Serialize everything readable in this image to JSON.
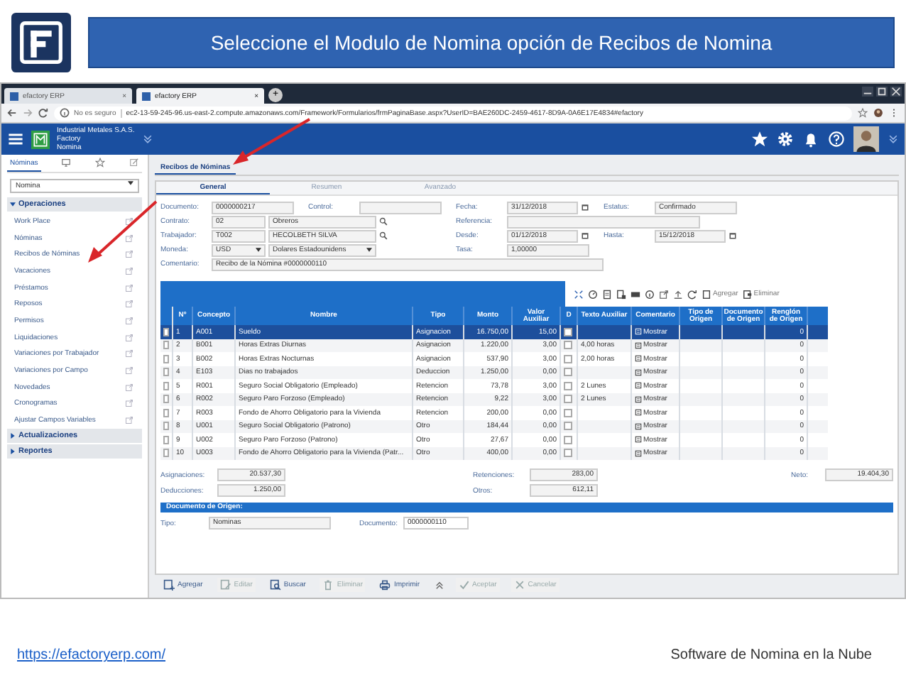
{
  "slide": {
    "title": "Seleccione el Modulo de Nomina opción de Recibos de Nomina",
    "link": "https://efactoryerp.com/",
    "tagline": "Software de Nomina en la Nube"
  },
  "browser": {
    "tabs": [
      {
        "label": "efactory ERP",
        "close": "×",
        "selected": false
      },
      {
        "label": "efactory ERP",
        "close": "×",
        "selected": true
      }
    ],
    "new_tab": "+",
    "security": "No es seguro",
    "url": "ec2-13-59-245-96.us-east-2.compute.amazonaws.com/Framework/Formularios/frmPaginaBase.aspx?UserID=BAE260DC-2459-4617-8D9A-0A6E17E4834#efactory"
  },
  "app_header": {
    "company": "Industrial Metales S.A.S.",
    "lines": [
      "Factory",
      "Nomina"
    ]
  },
  "sidebar": {
    "tabs": [
      {
        "kind": "text",
        "label": "Nóminas",
        "selected": true
      },
      {
        "kind": "monitor",
        "selected": false
      },
      {
        "kind": "star",
        "selected": false
      },
      {
        "kind": "edit",
        "selected": false
      }
    ],
    "module": "Nomina",
    "sections": [
      {
        "label": "Operaciones",
        "expanded": true,
        "items": [
          "Work Place",
          "Nóminas",
          "Recibos de Nóminas",
          "Vacaciones",
          "Préstamos",
          "Reposos",
          "Permisos",
          "Liquidaciones",
          "Variaciones por Trabajador",
          "Variaciones por Campo",
          "Novedades",
          "Cronogramas",
          "Ajustar Campos Variables"
        ]
      },
      {
        "label": "Actualizaciones",
        "expanded": false
      },
      {
        "label": "Reportes",
        "expanded": false
      }
    ]
  },
  "page_tab": "Recibos de Nóminas",
  "subtabs": [
    {
      "label": "General",
      "selected": true
    },
    {
      "label": "Resumen",
      "selected": false
    },
    {
      "label": "Avanzado",
      "selected": false
    }
  ],
  "form": [
    [
      {
        "kind": "short",
        "label": "Documento:",
        "value": "0000000217"
      },
      {
        "kind": "short",
        "label": "Control:"
      },
      {
        "kind": "date",
        "label": "Fecha:",
        "value": "31/12/2018"
      },
      {
        "kind": "short",
        "label": "Estatus:",
        "value": "Confirmado"
      }
    ],
    [
      {
        "kind": "pair",
        "label": "Contrato:",
        "value": "02",
        "value2": "Obreros"
      },
      {
        "kind": "wide",
        "label": "Referencia:"
      }
    ],
    [
      {
        "kind": "pair",
        "label": "Trabajador:",
        "value": "T002",
        "value2": "HECOLBETH SILVA"
      },
      {
        "kind": "date",
        "label": "Desde:",
        "value": "01/12/2018"
      },
      {
        "kind": "date",
        "label": "Hasta:",
        "value": "15/12/2018"
      }
    ],
    [
      {
        "kind": "select",
        "label": "Moneda:",
        "value": "USD",
        "value2": "Dolares Estadounidens"
      },
      {
        "kind": "short",
        "label": "Tasa:",
        "value": "1,00000"
      }
    ],
    [
      {
        "kind": "comment",
        "label": "Comentario:",
        "value": "Recibo de la Nómina #0000000110"
      }
    ]
  ],
  "table_toolbar": {
    "buttons": [
      "Agregar",
      "Eliminar"
    ]
  },
  "table": {
    "columns": [
      "Nº",
      "Concepto",
      "Nombre",
      "Tipo",
      "Monto",
      "Valor Auxiliar",
      "D",
      "Texto Auxiliar",
      "Comentario",
      "Tipo de Origen",
      "Documento de Origen",
      "Renglón de Origen"
    ],
    "rows": [
      {
        "n": "1",
        "concepto": "A001",
        "nombre": "Sueldo",
        "tipo": "Asignacion",
        "monto": "16.750,00",
        "valor": "15,00",
        "texto": "",
        "comentario": "Mostrar",
        "renglon": "0",
        "selected": true,
        "checked": false,
        "aux_checked": false
      },
      {
        "n": "2",
        "concepto": "B001",
        "nombre": "Horas Extras Diurnas",
        "tipo": "Asignacion",
        "monto": "1.220,00",
        "valor": "3,00",
        "texto": "4,00 horas",
        "comentario": "Mostrar",
        "renglon": "0",
        "selected": false,
        "checked": false,
        "aux_checked": false
      },
      {
        "n": "3",
        "concepto": "B002",
        "nombre": "Horas Extras Nocturnas",
        "tipo": "Asignacion",
        "monto": "537,90",
        "valor": "3,00",
        "texto": "2,00 horas",
        "comentario": "Mostrar",
        "renglon": "0",
        "selected": false,
        "checked": false,
        "aux_checked": false
      },
      {
        "n": "4",
        "concepto": "E103",
        "nombre": "Dias no trabajados",
        "tipo": "Deduccion",
        "monto": "1.250,00",
        "valor": "0,00",
        "texto": "",
        "comentario": "Mostrar",
        "renglon": "0",
        "selected": false,
        "checked": false,
        "aux_checked": false
      },
      {
        "n": "5",
        "concepto": "R001",
        "nombre": "Seguro Social Obligatorio (Empleado)",
        "tipo": "Retencion",
        "monto": "73,78",
        "valor": "3,00",
        "texto": "2 Lunes",
        "comentario": "Mostrar",
        "renglon": "0",
        "selected": false,
        "checked": false,
        "aux_checked": false
      },
      {
        "n": "6",
        "concepto": "R002",
        "nombre": "Seguro Paro Forzoso (Empleado)",
        "tipo": "Retencion",
        "monto": "9,22",
        "valor": "3,00",
        "texto": "2 Lunes",
        "comentario": "Mostrar",
        "renglon": "0",
        "selected": false,
        "checked": false,
        "aux_checked": false
      },
      {
        "n": "7",
        "concepto": "R003",
        "nombre": "Fondo de Ahorro Obligatorio para la Vivienda",
        "tipo": "Retencion",
        "monto": "200,00",
        "valor": "0,00",
        "texto": "",
        "comentario": "Mostrar",
        "renglon": "0",
        "selected": false,
        "checked": false,
        "aux_checked": false
      },
      {
        "n": "8",
        "concepto": "U001",
        "nombre": "Seguro Social Obligatorio (Patrono)",
        "tipo": "Otro",
        "monto": "184,44",
        "valor": "0,00",
        "texto": "",
        "comentario": "Mostrar",
        "renglon": "0",
        "selected": false,
        "checked": false,
        "aux_checked": false
      },
      {
        "n": "9",
        "concepto": "U002",
        "nombre": "Seguro Paro Forzoso (Patrono)",
        "tipo": "Otro",
        "monto": "27,67",
        "valor": "0,00",
        "texto": "",
        "comentario": "Mostrar",
        "renglon": "0",
        "selected": false,
        "checked": false,
        "aux_checked": false
      },
      {
        "n": "10",
        "concepto": "U003",
        "nombre": "Fondo de Ahorro Obligatorio para la Vivienda (Patr...",
        "tipo": "Otro",
        "monto": "400,00",
        "valor": "0,00",
        "texto": "",
        "comentario": "Mostrar",
        "renglon": "0",
        "selected": false,
        "checked": false,
        "aux_checked": false
      }
    ]
  },
  "totals": [
    {
      "label": "Asignaciones:",
      "value": "20.537,30"
    },
    {
      "label": "Retenciones:",
      "value": "283,00"
    },
    {
      "label": "Neto:",
      "value": "19.404,30"
    },
    {
      "label": "Deducciones:",
      "value": "1.250,00"
    },
    {
      "label": "Otros:",
      "value": "612,11"
    }
  ],
  "origin": {
    "title": "Documento de Origen:",
    "fields": [
      {
        "label": "Tipo:",
        "value": "Nominas"
      },
      {
        "label": "Documento:",
        "value": "0000000110"
      }
    ]
  },
  "actions": [
    {
      "kind": "add",
      "label": "Agregar",
      "disabled": false
    },
    {
      "kind": "edit",
      "label": "Editar",
      "disabled": true
    },
    {
      "kind": "search",
      "label": "Buscar",
      "disabled": false
    },
    {
      "kind": "delete",
      "label": "Eliminar",
      "disabled": true
    },
    {
      "kind": "print",
      "label": "Imprimir",
      "disabled": false
    },
    {
      "kind": "accept",
      "label": "Aceptar",
      "disabled": true
    },
    {
      "kind": "cancel",
      "label": "Cancelar",
      "disabled": true
    }
  ]
}
